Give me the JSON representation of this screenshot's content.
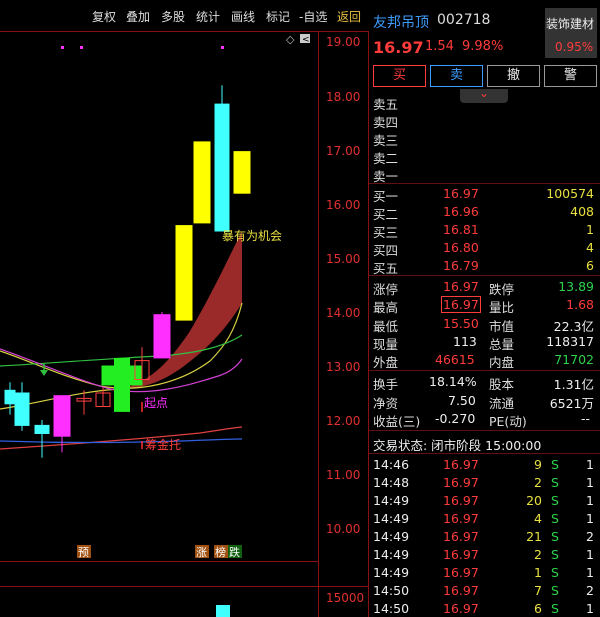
{
  "toolbar": {
    "buttons": [
      {
        "key": "fuquan",
        "label": "复权"
      },
      {
        "key": "diejia",
        "label": "叠加"
      },
      {
        "key": "duogu",
        "label": "多股"
      },
      {
        "key": "tongji",
        "label": "统计"
      },
      {
        "key": "huaxian",
        "label": "画线"
      },
      {
        "key": "biaoji",
        "label": "标记"
      },
      {
        "key": "zixuan",
        "label": "-自选"
      },
      {
        "key": "fanhui",
        "label": "返回"
      }
    ]
  },
  "chart": {
    "price_ticks": [
      "19.00",
      "18.00",
      "17.00",
      "16.00",
      "15.00",
      "14.00",
      "13.00",
      "12.00",
      "11.00",
      "10.00"
    ],
    "volume_tick": "15000",
    "annotations": {
      "opportunity": "暴有为机会",
      "buy_point": "起点",
      "support": "筹金托"
    },
    "markers": {
      "yu": "预",
      "zhang": "涨",
      "bang": "榜",
      "die": "跌"
    },
    "toolbar_icon": "diamond-icon",
    "nav_icon": "chevron-left-icon"
  },
  "chart_data": {
    "type": "candlestick",
    "candles": [
      {
        "open": 12.3,
        "close": 12.55,
        "high": 12.7,
        "low": 12.1,
        "color": "#40ffff"
      },
      {
        "open": 11.9,
        "close": 12.5,
        "high": 12.7,
        "low": 11.8,
        "color": "#40ffff"
      },
      {
        "open": 11.75,
        "close": 11.9,
        "high": 12.0,
        "low": 11.3,
        "color": "#40ffff"
      },
      {
        "open": 11.7,
        "close": 12.45,
        "high": 12.45,
        "low": 11.4,
        "color": "#ff30ff"
      },
      {
        "open": 12.35,
        "close": 12.4,
        "high": 12.55,
        "low": 12.1,
        "color": "#ff4040"
      },
      {
        "open": 12.25,
        "close": 12.5,
        "high": 12.6,
        "low": 12.25,
        "color": "#ff4040"
      },
      {
        "open": 12.65,
        "close": 13.0,
        "high": 13.15,
        "low": 12.2,
        "color": "#22ee22"
      },
      {
        "open": 12.75,
        "close": 13.1,
        "high": 13.35,
        "low": 12.75,
        "color": "#ff4040"
      },
      {
        "open": 13.15,
        "close": 13.95,
        "high": 14.0,
        "low": 13.15,
        "color": "#ff30ff"
      },
      {
        "open": 13.85,
        "close": 15.6,
        "high": 15.6,
        "low": 13.85,
        "color": "#ffff00"
      },
      {
        "open": 15.65,
        "close": 17.15,
        "high": 17.15,
        "low": 15.65,
        "color": "#ffff00"
      },
      {
        "open": 17.85,
        "close": 15.5,
        "high": 18.2,
        "low": 15.5,
        "color": "#40ffff"
      },
      {
        "open": 16.2,
        "close": 16.97,
        "high": 16.97,
        "low": 16.2,
        "color": "#ffff00"
      }
    ],
    "ylim": [
      9.6,
      19.2
    ]
  },
  "stock": {
    "name": "友邦吊顶",
    "code": "002718",
    "price": "16.97",
    "change": "1.54",
    "change_pct": "9.98%",
    "sector": "装饰建材",
    "sector_pct": "0.95%"
  },
  "actions": {
    "buy": "买",
    "sell": "卖",
    "cancel": "撤",
    "alert": "警"
  },
  "asks": [
    {
      "label": "卖五",
      "price": "",
      "vol": ""
    },
    {
      "label": "卖四",
      "price": "",
      "vol": ""
    },
    {
      "label": "卖三",
      "price": "",
      "vol": ""
    },
    {
      "label": "卖二",
      "price": "",
      "vol": ""
    },
    {
      "label": "卖一",
      "price": "",
      "vol": ""
    }
  ],
  "bids": [
    {
      "label": "买一",
      "price": "16.97",
      "vol": "100574"
    },
    {
      "label": "买二",
      "price": "16.96",
      "vol": "408"
    },
    {
      "label": "买三",
      "price": "16.81",
      "vol": "1"
    },
    {
      "label": "买四",
      "price": "16.80",
      "vol": "4"
    },
    {
      "label": "买五",
      "price": "16.79",
      "vol": "6"
    }
  ],
  "stats": {
    "zhangting_l": "涨停",
    "zhangting": "16.97",
    "dieting_l": "跌停",
    "dieting": "13.89",
    "zuigao_l": "最高",
    "zuigao": "16.97",
    "liangbi_l": "量比",
    "liangbi": "1.68",
    "zuidi_l": "最低",
    "zuidi": "15.50",
    "shizhi_l": "市值",
    "shizhi": "22.3亿",
    "xianliang_l": "现量",
    "xianliang": "113",
    "zongliang_l": "总量",
    "zongliang": "118317",
    "waipan_l": "外盘",
    "waipan": "46615",
    "neipan_l": "内盘",
    "neipan": "71702",
    "huanshou_l": "换手",
    "huanshou": "18.14%",
    "guben_l": "股本",
    "guben": "1.31亿",
    "jingzi_l": "净资",
    "jingzi": "7.50",
    "liutong_l": "流通",
    "liutong": "6521万",
    "shouyi_l": "收益(三)",
    "shouyi": "-0.270",
    "pe_l": "PE(动)",
    "pe": "--"
  },
  "trade_status": "交易状态: 闭市阶段 15:00:00",
  "ticks": [
    {
      "time": "14:46",
      "price": "16.97",
      "vol": "9",
      "side": "S",
      "n": "1"
    },
    {
      "time": "14:48",
      "price": "16.97",
      "vol": "2",
      "side": "S",
      "n": "1"
    },
    {
      "time": "14:49",
      "price": "16.97",
      "vol": "20",
      "side": "S",
      "n": "1"
    },
    {
      "time": "14:49",
      "price": "16.97",
      "vol": "4",
      "side": "S",
      "n": "1"
    },
    {
      "time": "14:49",
      "price": "16.97",
      "vol": "21",
      "side": "S",
      "n": "2"
    },
    {
      "time": "14:49",
      "price": "16.97",
      "vol": "2",
      "side": "S",
      "n": "1"
    },
    {
      "time": "14:49",
      "price": "16.97",
      "vol": "1",
      "side": "S",
      "n": "1"
    },
    {
      "time": "14:50",
      "price": "16.97",
      "vol": "7",
      "side": "S",
      "n": "2"
    },
    {
      "time": "14:50",
      "price": "16.97",
      "vol": "6",
      "side": "S",
      "n": "1"
    }
  ],
  "colors": {
    "up": "#ff3b3b",
    "down": "#2bd24a",
    "neutral": "#eee",
    "frame": "#8a1010"
  }
}
